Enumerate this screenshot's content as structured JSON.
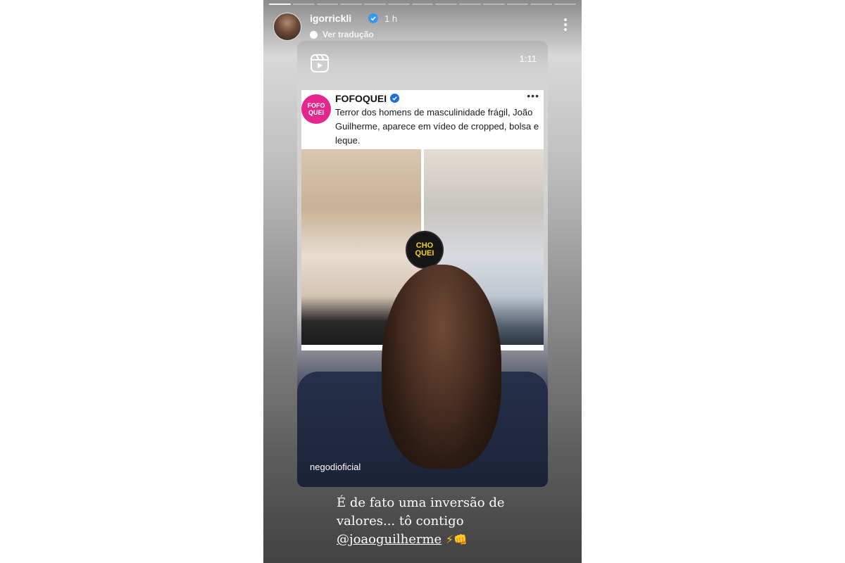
{
  "story": {
    "progress_total": 13,
    "progress_done": 1,
    "username": "igorrickli",
    "time": "1 h",
    "translate_label": "Ver tradução"
  },
  "reel": {
    "duration": "1:11",
    "post": {
      "account": "FOFOQUEI",
      "logo_text": "FOFO QUEI",
      "more": "•••",
      "text": "Terror dos homens de masculinidade frágil, João Guilherme, aparece em vídeo de cropped, bolsa e leque.",
      "choquei_badge": "CHO QUEI"
    },
    "author_handle": "negodioficial"
  },
  "caption": {
    "line1": "É de fato uma inversão de",
    "line2": "valores...  tô contigo",
    "mention": "@joaoguilherme",
    "emoji": "⚡👊"
  },
  "colors": {
    "accent_pink": "#e3278c",
    "verified_blue": "#3897f0",
    "choquei_yellow": "#f3d21b"
  }
}
